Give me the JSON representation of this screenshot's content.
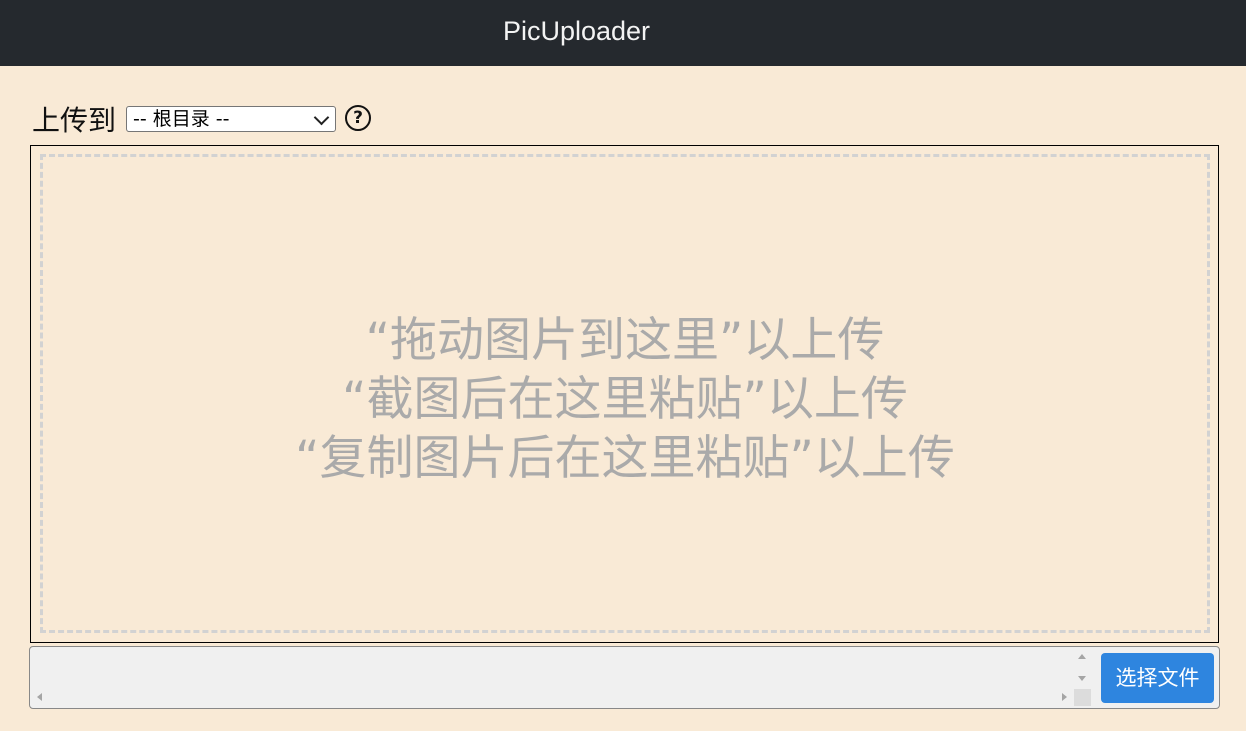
{
  "header": {
    "brand": "PicUploader"
  },
  "upload": {
    "label": "上传到",
    "folder_selected": "-- 根目录 --",
    "help_icon": "question-circle-icon"
  },
  "dropzone": {
    "lines": [
      "“拖动图片到这里”以上传",
      "“截图后在这里粘贴”以上传",
      "“复制图片后在这里粘贴”以上传"
    ]
  },
  "file_input": {
    "button_label": "选择文件"
  },
  "colors": {
    "navbar": "#25292e",
    "background": "#f9ead6",
    "button": "#2e85df",
    "drop_text": "#aaaaaa"
  }
}
